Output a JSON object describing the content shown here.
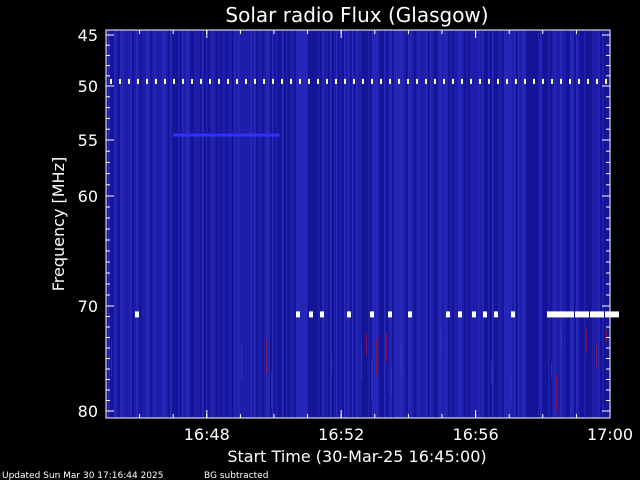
{
  "chart_data": {
    "type": "heatmap",
    "title": "Solar radio Flux (Glasgow)",
    "xlabel": "Start Time (30-Mar-25 16:45:00)",
    "ylabel": "Frequency [MHz]",
    "x_range": [
      "16:45:00",
      "17:00:00"
    ],
    "y_range_mhz": [
      45,
      80
    ],
    "y_scale": "nonlinear (compressed toward high frequency)",
    "x_ticks": [
      "16:48",
      "16:52",
      "16:56",
      "17:00"
    ],
    "y_ticks": [
      "45",
      "50",
      "55",
      "60",
      "70",
      "80"
    ],
    "grid": false,
    "background_color": "#1a1aa0",
    "features": [
      {
        "label": "periodic interference",
        "freq_mhz": 49.5,
        "t_start": "16:45:00",
        "t_end": "17:00:00",
        "color": "#ffffa0"
      },
      {
        "label": "emission band",
        "freq_mhz": 54.5,
        "t_start": "16:47:00",
        "t_end": "16:50:10",
        "color": "#3030ff"
      },
      {
        "label": "interference bursts",
        "freq_mhz": 70.8,
        "t_start": "16:45:30",
        "t_end": "17:00:00",
        "color": "#ffffff"
      },
      {
        "label": "noisy lower band",
        "freq_mhz_range": [
          72,
          80
        ],
        "color": "#c01030"
      }
    ]
  },
  "footer": {
    "updated": "Updated Sun Mar 30 17:16:44 2025",
    "note": "BG subtracted"
  }
}
